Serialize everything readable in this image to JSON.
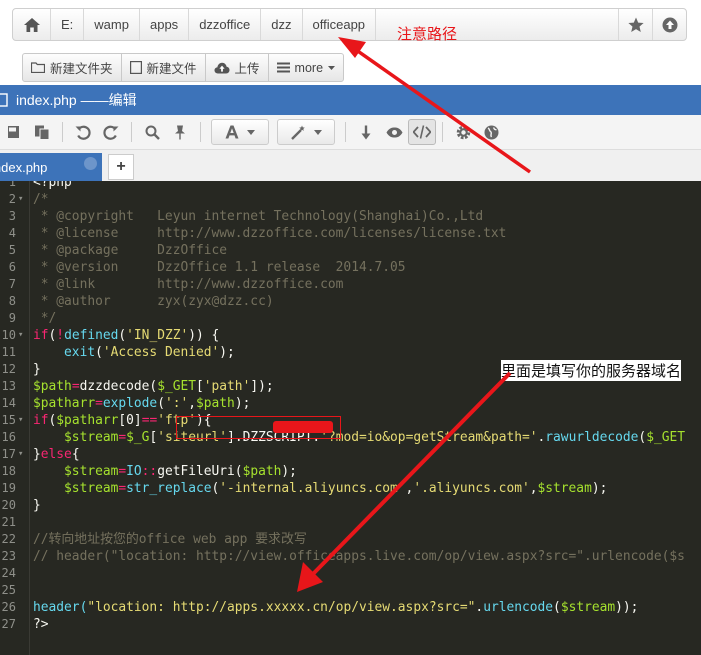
{
  "breadcrumb": {
    "items": [
      "E:",
      "wamp",
      "apps",
      "dzzoffice",
      "dzz",
      "officeapp"
    ]
  },
  "toolbar": {
    "new_folder": "新建文件夹",
    "new_file": "新建文件",
    "upload": "上传",
    "more": "more"
  },
  "editor": {
    "title": "index.php ——编辑",
    "tab_label": "index.php",
    "new_tab": "+"
  },
  "annotations": {
    "path_note": "注意路径",
    "domain_note": "里面是填写你的服务器域名"
  },
  "code": {
    "lines": [
      {
        "n": "1",
        "fold": "",
        "segs": [
          {
            "t": "<?php",
            "c": "pln"
          }
        ]
      },
      {
        "n": "2",
        "fold": "▾",
        "segs": [
          {
            "t": "/*",
            "c": "com"
          }
        ]
      },
      {
        "n": "3",
        "fold": "",
        "segs": [
          {
            "t": " * @copyright   Leyun internet Technology(Shanghai)Co.,Ltd",
            "c": "com"
          }
        ]
      },
      {
        "n": "4",
        "fold": "",
        "segs": [
          {
            "t": " * @license     http://www.dzzoffice.com/licenses/license.txt",
            "c": "com"
          }
        ]
      },
      {
        "n": "5",
        "fold": "",
        "segs": [
          {
            "t": " * @package     DzzOffice",
            "c": "com"
          }
        ]
      },
      {
        "n": "6",
        "fold": "",
        "segs": [
          {
            "t": " * @version     DzzOffice 1.1 release  2014.7.05",
            "c": "com"
          }
        ]
      },
      {
        "n": "7",
        "fold": "",
        "segs": [
          {
            "t": " * @link        http://www.dzzoffice.com",
            "c": "com"
          }
        ]
      },
      {
        "n": "8",
        "fold": "",
        "segs": [
          {
            "t": " * @author      zyx(zyx@dzz.cc)",
            "c": "com"
          }
        ]
      },
      {
        "n": "9",
        "fold": "",
        "segs": [
          {
            "t": " */",
            "c": "com"
          }
        ]
      },
      {
        "n": "10",
        "fold": "▾",
        "segs": [
          {
            "t": "if",
            "c": "kw"
          },
          {
            "t": "(",
            "c": "pln"
          },
          {
            "t": "!",
            "c": "kw"
          },
          {
            "t": "defined",
            "c": "fn"
          },
          {
            "t": "(",
            "c": "pln"
          },
          {
            "t": "'IN_DZZ'",
            "c": "str"
          },
          {
            "t": ")) {",
            "c": "pln"
          }
        ]
      },
      {
        "n": "11",
        "fold": "",
        "segs": [
          {
            "t": "    exit",
            "c": "fn"
          },
          {
            "t": "(",
            "c": "pln"
          },
          {
            "t": "'Access Denied'",
            "c": "str"
          },
          {
            "t": ");",
            "c": "pln"
          }
        ]
      },
      {
        "n": "12",
        "fold": "",
        "segs": [
          {
            "t": "}",
            "c": "pln"
          }
        ]
      },
      {
        "n": "13",
        "fold": "",
        "segs": [
          {
            "t": "$path",
            "c": "var"
          },
          {
            "t": "=",
            "c": "kw"
          },
          {
            "t": "dzzdecode(",
            "c": "pln"
          },
          {
            "t": "$_GET",
            "c": "var"
          },
          {
            "t": "[",
            "c": "pln"
          },
          {
            "t": "'path'",
            "c": "str"
          },
          {
            "t": "]);",
            "c": "pln"
          }
        ]
      },
      {
        "n": "14",
        "fold": "",
        "segs": [
          {
            "t": "$patharr",
            "c": "var"
          },
          {
            "t": "=",
            "c": "kw"
          },
          {
            "t": "explode",
            "c": "fn"
          },
          {
            "t": "(",
            "c": "pln"
          },
          {
            "t": "':'",
            "c": "str"
          },
          {
            "t": ",",
            "c": "pln"
          },
          {
            "t": "$path",
            "c": "var"
          },
          {
            "t": ");",
            "c": "pln"
          }
        ]
      },
      {
        "n": "15",
        "fold": "▾",
        "segs": [
          {
            "t": "if",
            "c": "kw"
          },
          {
            "t": "(",
            "c": "pln"
          },
          {
            "t": "$patharr",
            "c": "var"
          },
          {
            "t": "[0]",
            "c": "pln"
          },
          {
            "t": "==",
            "c": "kw"
          },
          {
            "t": "'ftp'",
            "c": "str"
          },
          {
            "t": "){",
            "c": "pln"
          }
        ]
      },
      {
        "n": "16",
        "fold": "",
        "segs": [
          {
            "t": "    $stream",
            "c": "var"
          },
          {
            "t": "=",
            "c": "kw"
          },
          {
            "t": "$_G",
            "c": "var"
          },
          {
            "t": "[",
            "c": "pln"
          },
          {
            "t": "'siteurl'",
            "c": "str"
          },
          {
            "t": "].DZZSCRIPT.",
            "c": "pln"
          },
          {
            "t": "'?mod=io&op=getStream&path='",
            "c": "str"
          },
          {
            "t": ".",
            "c": "pln"
          },
          {
            "t": "rawurldecode",
            "c": "fn"
          },
          {
            "t": "(",
            "c": "pln"
          },
          {
            "t": "$_GET",
            "c": "var"
          }
        ]
      },
      {
        "n": "17",
        "fold": "▾",
        "segs": [
          {
            "t": "}",
            "c": "pln"
          },
          {
            "t": "else",
            "c": "kw"
          },
          {
            "t": "{",
            "c": "pln"
          }
        ]
      },
      {
        "n": "18",
        "fold": "",
        "segs": [
          {
            "t": "    $stream",
            "c": "var"
          },
          {
            "t": "=",
            "c": "kw"
          },
          {
            "t": "IO",
            "c": "fn"
          },
          {
            "t": "::",
            "c": "kw"
          },
          {
            "t": "getFileUri(",
            "c": "pln"
          },
          {
            "t": "$path",
            "c": "var"
          },
          {
            "t": ");",
            "c": "pln"
          }
        ]
      },
      {
        "n": "19",
        "fold": "",
        "segs": [
          {
            "t": "    $stream",
            "c": "var"
          },
          {
            "t": "=",
            "c": "kw"
          },
          {
            "t": "str_replace",
            "c": "fn"
          },
          {
            "t": "(",
            "c": "pln"
          },
          {
            "t": "'-internal.aliyuncs.com'",
            "c": "str"
          },
          {
            "t": ",",
            "c": "pln"
          },
          {
            "t": "'.aliyuncs.com'",
            "c": "str"
          },
          {
            "t": ",",
            "c": "pln"
          },
          {
            "t": "$stream",
            "c": "var"
          },
          {
            "t": ");",
            "c": "pln"
          }
        ]
      },
      {
        "n": "20",
        "fold": "",
        "segs": [
          {
            "t": "}",
            "c": "pln"
          }
        ]
      },
      {
        "n": "21",
        "fold": "",
        "segs": []
      },
      {
        "n": "22",
        "fold": "",
        "segs": [
          {
            "t": "//转向地址按您的office web app 要求改写",
            "c": "com"
          }
        ]
      },
      {
        "n": "23",
        "fold": "",
        "segs": [
          {
            "t": "// header(\"location: http://view.officeapps.live.com/op/view.aspx?src=\".urlencode($s",
            "c": "com"
          }
        ]
      },
      {
        "n": "24",
        "fold": "",
        "segs": []
      },
      {
        "n": "25",
        "fold": "",
        "segs": []
      },
      {
        "n": "26",
        "fold": "",
        "segs": [
          {
            "t": "header(",
            "c": "fn"
          },
          {
            "t": "\"location: ",
            "c": "str"
          },
          {
            "t": "http://apps.",
            "c": "str"
          },
          {
            "t": "xxxxx",
            "c": "str"
          },
          {
            "t": ".cn",
            "c": "str"
          },
          {
            "t": "/op/view.aspx?src=\"",
            "c": "str"
          },
          {
            "t": ".",
            "c": "pln"
          },
          {
            "t": "urlencode",
            "c": "fn"
          },
          {
            "t": "(",
            "c": "pln"
          },
          {
            "t": "$stream",
            "c": "var"
          },
          {
            "t": "));",
            "c": "pln"
          }
        ]
      },
      {
        "n": "27",
        "fold": "",
        "segs": [
          {
            "t": "?>",
            "c": "pln"
          }
        ]
      }
    ]
  },
  "colors": {
    "accent": "#3d73b9",
    "annotation_red": "#e8161a",
    "editor_bg": "#272822"
  }
}
